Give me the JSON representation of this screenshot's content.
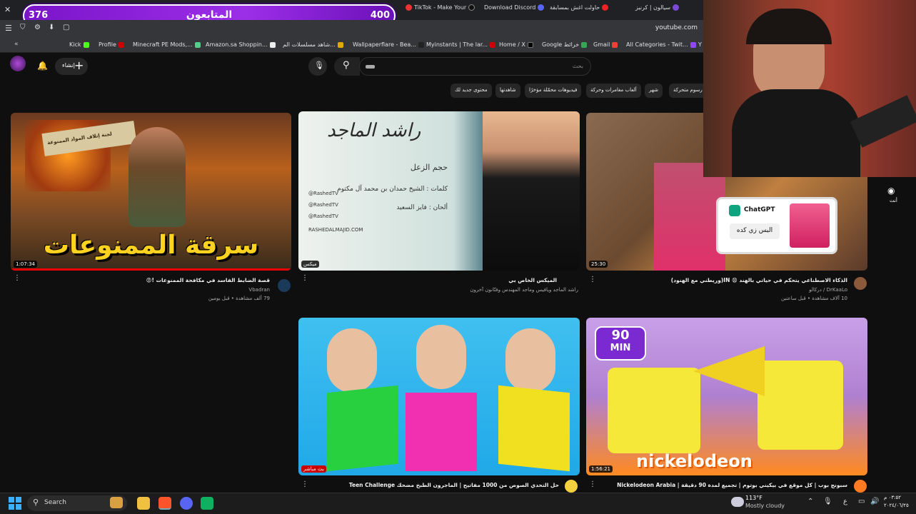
{
  "browser": {
    "tabs": [
      "TikTok - Make Your",
      "Download Discord",
      "حاولت اغش بمسابقة",
      "سيالون | كرنيز"
    ],
    "url": "youtube.com",
    "bookmarks": [
      "Kick",
      "Profile",
      "Minecraft PE Mods,...",
      "Amazon.sa Shoppin...",
      "شاهد مسلسلات الم...",
      "Wallpaperflare - Bea...",
      "Myinstants | The lar...",
      "Home / X",
      "Google خرائط",
      "Gmail",
      "All Categories - Twit...",
      "Y"
    ]
  },
  "overlay": {
    "followers_title": "المتابعون",
    "current": "376",
    "goal": "400"
  },
  "youtube": {
    "create_label": "إنشاء",
    "search_placeholder": "بحث",
    "chips": [
      "رسوم متحركة",
      "شهر",
      "ألعاب مغامرات وحركة",
      "فيديوهات محمّلة مؤخرًا",
      "شاهدتها",
      "محتوى جديد لك"
    ],
    "sidebar_you": "أنت",
    "videos": [
      {
        "title": "قصة الضابط الفاسد في مكافحة الممنوعات !😡",
        "channel": "Vbadran",
        "meta": "79 ألف مشاهدة • قبل يومين",
        "duration": "1:07:34",
        "thumb_text": "سرقة الممنوعات",
        "thumb_sign": "لجنة إتلاف المواد الممنوعة"
      },
      {
        "title": "الميكس الخاص بي",
        "channel": "راشد الماجد ويافيس وماجد المهندس وفنّانون آخرون",
        "meta": "",
        "duration": "ميكس",
        "thumb_lines": [
          "حجم الزعل",
          "كلمات : الشيخ حمدان بن محمد آل مكتوم",
          "ألحان : فايز السعيد"
        ],
        "handles": [
          "@RashedTV",
          "@RashedTV",
          "@RashedTV"
        ],
        "site": "RASHEDALMAJID.COM",
        "logo": "راشد الماجد"
      },
      {
        "title": "الذكاء الاصطناعي يتحكم في حياتي بالهند 😧 IN(وريطني مع الهنود)",
        "channel": "DrKaaLo / دركالو",
        "meta": "10 آلاف مشاهدة • قبل ساعتين",
        "duration": "25:30",
        "gpt_label": "ChatGPT",
        "gpt_prompt": "البس زي كده"
      },
      {
        "title": "حل التحدي الصوص من 1000 مفاتيح | الماجرون الطبخ مضحك Teen Challenge",
        "channel": "",
        "meta": "",
        "duration": "بث مباشر"
      },
      {
        "title": "سبونج بوب | كل موقع في بيكيني بوتوم | تجميع لمدة 90 دقيقة | Nickelodeon Arabia",
        "channel": "",
        "meta": "",
        "duration": "1:56:21",
        "badge_top": "90",
        "badge_bottom": "MIN",
        "brand": "nickelodeon"
      }
    ]
  },
  "taskbar": {
    "search": "Search",
    "weather_temp": "113°F",
    "weather_desc": "Mostly cloudy",
    "time": "٠٣:٥٢ م",
    "date": "٢٠٢٤/٠٦/٢٥",
    "lang": "ع"
  }
}
